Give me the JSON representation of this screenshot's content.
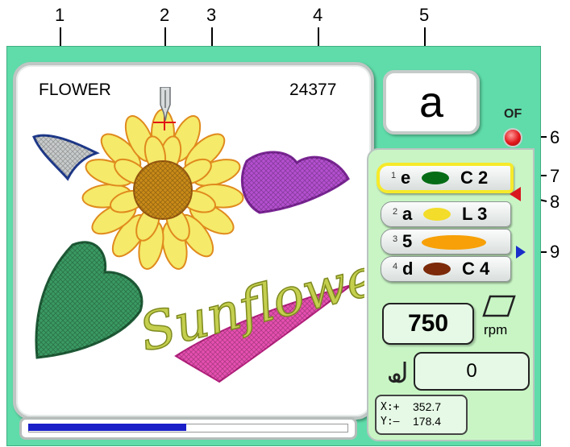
{
  "callouts": [
    "1",
    "2",
    "3",
    "4",
    "5",
    "6",
    "7",
    "8",
    "9"
  ],
  "display": {
    "design_name": "FLOWER",
    "stitch_count": "24377",
    "current_char": "a",
    "of_label": "OF"
  },
  "design_text": "Sunflower",
  "needles": [
    {
      "num": "1",
      "letter": "e",
      "color": "#066d16",
      "code": "C 2",
      "active": true
    },
    {
      "num": "2",
      "letter": "a",
      "color": "#f3dc2a",
      "code": "L 3",
      "active": false
    },
    {
      "num": "3",
      "letter": "5",
      "color": "#f7a007",
      "code": "",
      "active": false
    },
    {
      "num": "4",
      "letter": "d",
      "color": "#7c2a0a",
      "code": "C 4",
      "active": false
    }
  ],
  "speed": {
    "value": "750",
    "unit": "rpm"
  },
  "thread_counter": "0",
  "coords": {
    "x_label": "X:+",
    "x_value": "352.7",
    "y_label": "Y:–",
    "y_value": "178.4"
  },
  "progress": 0.5,
  "colors": {
    "panel": "#5fdca9",
    "side_panel": "#c9f5c5",
    "progress": "#1b1fc8",
    "active_needle_border": "#f6ea2a"
  },
  "icons": [
    "needle-icon",
    "of-lamp-icon",
    "current-needle-marker-icon",
    "next-needle-marker-icon",
    "frame-icon",
    "thread-icon"
  ]
}
